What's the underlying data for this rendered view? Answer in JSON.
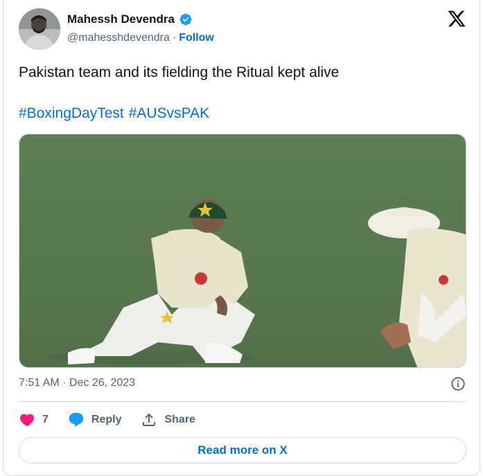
{
  "author": {
    "name": "Mahessh Devendra",
    "handle": "@mahesshdevendra",
    "separator": "·",
    "follow_label": "Follow"
  },
  "tweet": {
    "text": "Pakistan team and its fielding the Ritual kept alive",
    "hashtags": [
      "#BoxingDayTest",
      "#AUSvsPAK"
    ]
  },
  "meta": {
    "timestamp": "7:51 AM · Dec 26, 2023"
  },
  "actions": {
    "like_count": "7",
    "reply_label": "Reply",
    "share_label": "Share"
  },
  "footer": {
    "read_more_label": "Read more on X"
  },
  "colors": {
    "link": "#006fd6",
    "like": "#f91880",
    "muted": "#536471",
    "verified": "#1d9bf0"
  },
  "icons": {
    "verified": "verified-badge-icon",
    "logo": "x-logo-icon",
    "info": "info-icon",
    "like": "heart-icon",
    "reply": "reply-bubble-icon",
    "share": "share-upload-icon"
  }
}
